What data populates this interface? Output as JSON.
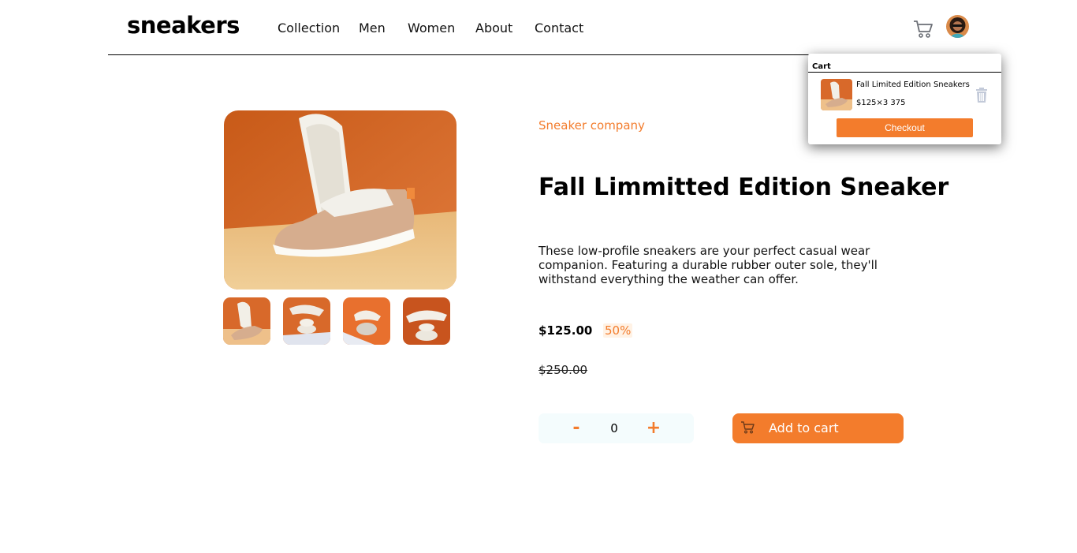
{
  "header": {
    "logo": "sneakers",
    "nav": [
      "Collection",
      "Men",
      "Women",
      "About",
      "Contact"
    ],
    "cart_icon": "cart-icon",
    "avatar_icon": "avatar"
  },
  "gallery": {
    "thumbnail_count": 4
  },
  "product": {
    "company": "Sneaker company",
    "title": "Fall Limmitted Edition Sneaker",
    "description": "These low-profile sneakers are your perfect casual wear companion. Featuring a durable rubber outer sole, they'll withstand everything the weather can offer.",
    "price": "$125.00",
    "discount": "50%",
    "original_price": "$250.00",
    "quantity": "0",
    "minus_label": "-",
    "plus_label": "+",
    "add_to_cart_label": "Add to cart"
  },
  "cart": {
    "heading": "Cart",
    "item_name": "Fall Limited Edition Sneakers",
    "item_price": "$125×3 375",
    "checkout_label": "Checkout",
    "delete_icon": "trash-icon"
  },
  "colors": {
    "accent": "#f37c2c",
    "accent_light": "#fff2e5",
    "quantity_bg": "#f4fcfd",
    "trash_icon": "#c3cad9"
  }
}
